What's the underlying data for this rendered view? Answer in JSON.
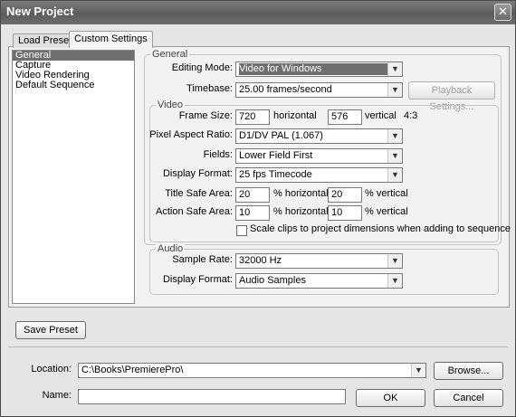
{
  "window": {
    "title": "New Project",
    "close_glyph": "✕"
  },
  "tabs": {
    "load_preset": "Load Preset",
    "custom_settings": "Custom Settings"
  },
  "nav_list": [
    "General",
    "Capture",
    "Video Rendering",
    "Default Sequence"
  ],
  "general": {
    "group_label": "General",
    "editing_mode_label": "Editing Mode:",
    "editing_mode_value": "Video for Windows",
    "timebase_label": "Timebase:",
    "timebase_value": "25.00 frames/second",
    "playback_settings_label": "Playback Settings..."
  },
  "video": {
    "group_label": "Video",
    "frame_size_label": "Frame Size:",
    "frame_width": "720",
    "horizontal_label": "horizontal",
    "frame_height": "576",
    "vertical_label": "vertical",
    "aspect": "4:3",
    "pixel_aspect_label": "Pixel Aspect Ratio:",
    "pixel_aspect_value": "D1/DV PAL (1.067)",
    "fields_label": "Fields:",
    "fields_value": "Lower Field First",
    "display_format_label": "Display Format:",
    "display_format_value": "25 fps Timecode",
    "title_safe_label": "Title Safe Area:",
    "title_safe_h": "20",
    "title_safe_v": "20",
    "action_safe_label": "Action Safe Area:",
    "action_safe_h": "10",
    "action_safe_v": "10",
    "pct_horizontal": "% horizontal",
    "pct_vertical": "% vertical",
    "scale_clips_label": "Scale clips to project dimensions when adding to sequence",
    "scale_clips_checked": false
  },
  "audio": {
    "group_label": "Audio",
    "sample_rate_label": "Sample Rate:",
    "sample_rate_value": "32000 Hz",
    "display_format_label": "Display Format:",
    "display_format_value": "Audio Samples"
  },
  "save_preset_label": "Save Preset",
  "location": {
    "label": "Location:",
    "value": "C:\\Books\\PremierePro\\",
    "browse_label": "Browse..."
  },
  "name": {
    "label": "Name:",
    "value": ""
  },
  "ok_label": "OK",
  "cancel_label": "Cancel",
  "icons": {
    "dropdown": "chevron-down-icon",
    "close": "close-icon"
  }
}
